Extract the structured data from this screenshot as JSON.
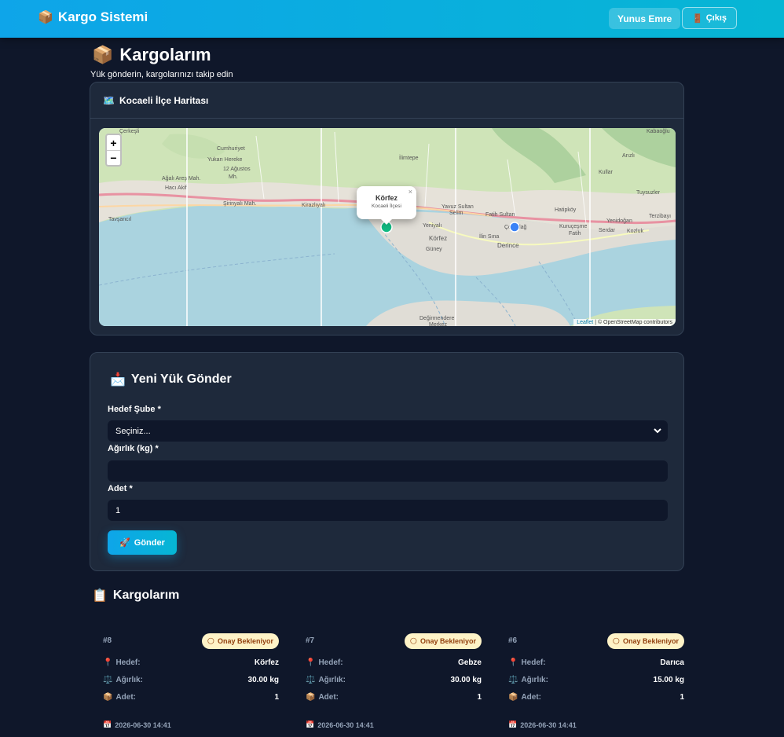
{
  "header": {
    "brand_icon": "📦",
    "brand": "Kargo Sistemi",
    "user_name": "Yunus Emre",
    "logout_icon": "🚪",
    "logout_label": "Çıkış"
  },
  "page": {
    "title_icon": "📦",
    "title": "Kargolarım",
    "subtitle": "Yük gönderin, kargolarınızı takip edin"
  },
  "map_card": {
    "icon": "🗺️",
    "title": "Kocaeli İlçe Haritası",
    "zoom_in": "+",
    "zoom_out": "−",
    "popup_title": "Körfez",
    "popup_subtitle": "Kocaeli İlçesi",
    "popup_close": "×",
    "attribution_link": "Leaflet",
    "attribution_text": "| © OpenStreetMap contributors",
    "place_labels": [
      "Çerkeşli",
      "Cumhuriyet",
      "Yukarı Hereke",
      "12 Ağustos Mh.",
      "Ağalı Areş Mah.",
      "Hacı Akif",
      "Tavşancıl",
      "Şirinyalı Mah.",
      "Kirazlıyalı",
      "İlimtepe",
      "Yavuz Sultan",
      "Selim",
      "Fatih Sultan",
      "Yeniyalı",
      "Körfez",
      "İlin Sına",
      "Çenedağ",
      "Derince",
      "Güney",
      "Hatipköy",
      "Kuruçeşme",
      "Fatih",
      "Serdar",
      "Yenidoğan",
      "Tuysuzler",
      "Terzibayı",
      "Kozluk",
      "Kabaoğlu",
      "Arızlı",
      "Kullar",
      "Değirmendere",
      "Merkez"
    ]
  },
  "form": {
    "icon": "📩",
    "title": "Yeni Yük Gönder",
    "target_label": "Hedef Şube *",
    "target_value": "Seçiniz...",
    "weight_label": "Ağırlık (kg) *",
    "weight_value": "",
    "count_label": "Adet *",
    "count_value": "1",
    "submit_icon": "🚀",
    "submit_label": "Gönder"
  },
  "shipments_section": {
    "icon": "📋",
    "title": "Kargolarım",
    "labels": {
      "target": "Hedef:",
      "weight": "Ağırlık:",
      "count": "Adet:"
    },
    "icons": {
      "target": "📍",
      "weight": "⚖️",
      "count": "📦",
      "date": "📅",
      "status": "🌕"
    },
    "items": [
      {
        "id": "#8",
        "status": "Onay Bekleniyor",
        "target": "Körfez",
        "weight": "30.00 kg",
        "count": "1",
        "date": "2026-06-30 14:41"
      },
      {
        "id": "#7",
        "status": "Onay Bekleniyor",
        "target": "Gebze",
        "weight": "30.00 kg",
        "count": "1",
        "date": "2026-06-30 14:41"
      },
      {
        "id": "#6",
        "status": "Onay Bekleniyor",
        "target": "Darıca",
        "weight": "15.00 kg",
        "count": "1",
        "date": "2026-06-30 14:41"
      }
    ]
  },
  "colors": {
    "accent": "#0ea5e9",
    "background": "#0f172a",
    "card": "#1e293b",
    "badge_bg": "#fef3c7",
    "badge_text": "#92400e"
  }
}
